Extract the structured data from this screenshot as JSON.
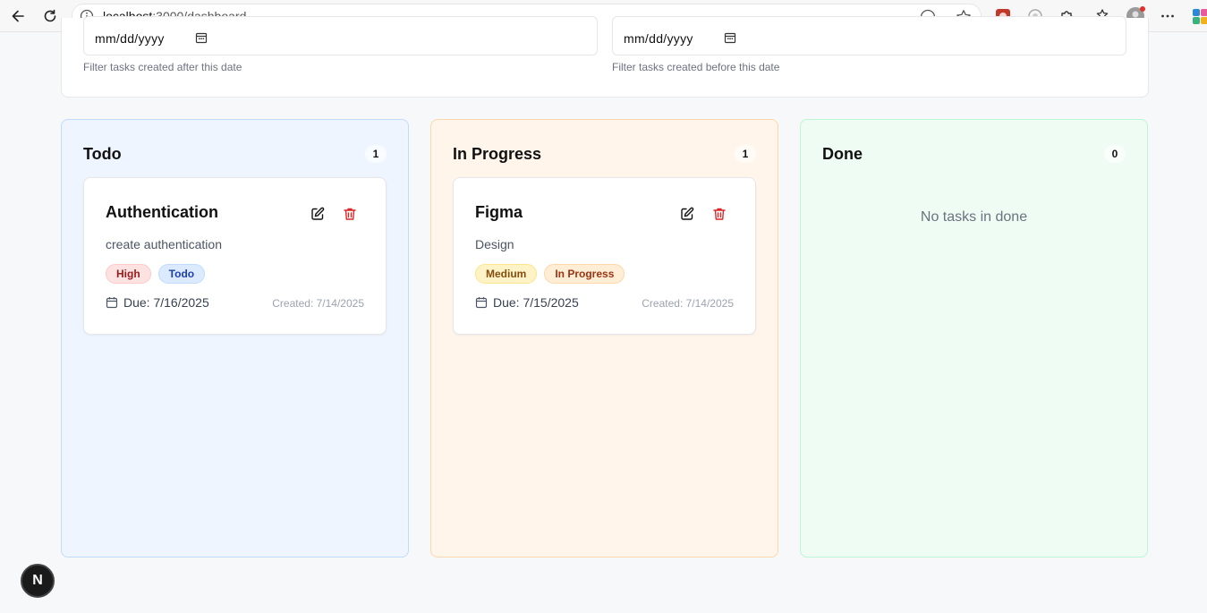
{
  "browser": {
    "url_host": "localhost",
    "url_path": ":3000/dashboard"
  },
  "filters": {
    "after": {
      "value": "mm/dd/yyyy",
      "hint": "Filter tasks created after this date"
    },
    "before": {
      "value": "mm/dd/yyyy",
      "hint": "Filter tasks created before this date"
    }
  },
  "columns": [
    {
      "title": "Todo",
      "count": "1",
      "tasks": [
        {
          "title": "Authentication",
          "description": "create authentication",
          "priority": "High",
          "status": "Todo",
          "due": "Due: 7/16/2025",
          "created": "Created: 7/14/2025"
        }
      ]
    },
    {
      "title": "In Progress",
      "count": "1",
      "tasks": [
        {
          "title": "Figma",
          "description": "Design",
          "priority": "Medium",
          "status": "In Progress",
          "due": "Due: 7/15/2025",
          "created": "Created: 7/14/2025"
        }
      ]
    },
    {
      "title": "Done",
      "count": "0",
      "empty_message": "No tasks in done",
      "tasks": []
    }
  ],
  "next_badge": {
    "label": "N"
  },
  "colors": {
    "todo_bg": "#eef5ff",
    "progress_bg": "#fff5eb",
    "done_bg": "#effcf3",
    "delete_red": "#dc2626"
  }
}
